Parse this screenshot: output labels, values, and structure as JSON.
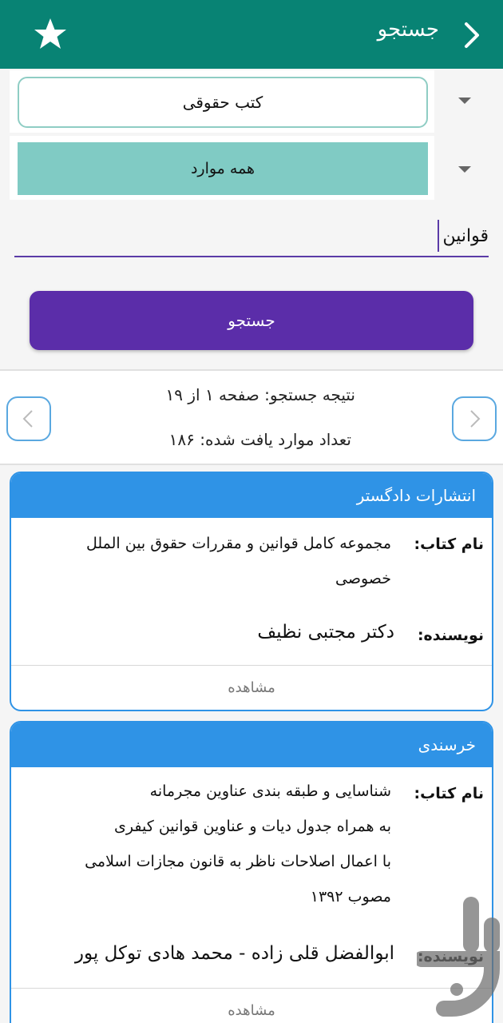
{
  "appbar": {
    "title": "جستجو",
    "back_icon": "chevron-right-icon",
    "favorite_icon": "star-icon"
  },
  "filters": {
    "category": "کتب حقوقی",
    "scope": "همه موارد"
  },
  "search": {
    "query": "قوانین",
    "button_label": "جستجو"
  },
  "results": {
    "page_text": "نتیجه جستجو: صفحه ۱ از ۱۹",
    "count_text": "تعداد موارد یافت شده: ۱۸۶"
  },
  "cards": [
    {
      "publisher": "انتشارات دادگستر",
      "book_label": "نام کتاب:",
      "book_lines": [
        "مجموعه کامل قوانین و مقررات حقوق بین الملل",
        "خصوصی"
      ],
      "author_label": "نویسنده:",
      "author": "دکتر مجتبی نظیف",
      "view_label": "مشاهده"
    },
    {
      "publisher": "خرسندی",
      "book_label": "نام کتاب:",
      "book_lines": [
        "شناسایی و طبقه بندی عناوین مجرمانه",
        "به همراه جدول دیات و عناوین قوانین کیفری",
        "با اعمال اصلاحات ناظر به قانون مجازات اسلامی",
        "مصوب ۱۳۹۲"
      ],
      "author_label": "نویسنده:",
      "author": "ابوالفضل قلی زاده - محمد هادی توکل پور",
      "view_label": "مشاهده"
    }
  ],
  "colors": {
    "appbar": "#088374",
    "button": "#5b2da9",
    "card_accent": "#2f93e6",
    "scope_fill": "#80cbc4"
  }
}
